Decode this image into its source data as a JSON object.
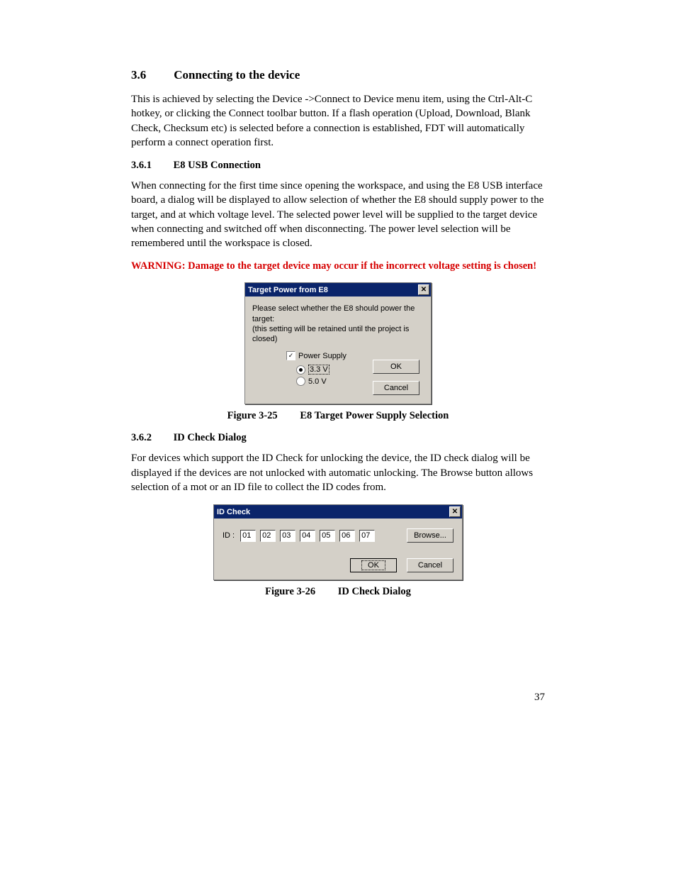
{
  "page_number": "37",
  "section": {
    "number": "3.6",
    "title": "Connecting to the device"
  },
  "para1": "This is achieved by selecting the Device ->Connect to Device menu item, using the Ctrl-Alt-C hotkey, or clicking the Connect toolbar button. If a flash operation (Upload, Download, Blank Check, Checksum etc) is selected before a connection is established, FDT will automatically perform a connect operation first.",
  "sub1": {
    "number": "3.6.1",
    "title": "E8 USB Connection"
  },
  "para2": "When connecting for the first time since opening the workspace, and using the E8 USB interface board, a dialog will be displayed to allow selection of whether the E8 should supply power to the target, and at which voltage level. The selected power level will be supplied to the target device when connecting and switched off when disconnecting. The power level selection will be remembered until the workspace is closed.",
  "warning": "WARNING: Damage to the target device may occur if the incorrect voltage setting is chosen!",
  "fig1": {
    "ref": "Figure 3-25",
    "caption": "E8 Target Power Supply Selection"
  },
  "tp": {
    "title": "Target Power from E8",
    "msg1": "Please select whether the E8 should power the target:",
    "msg2": "(this setting will be retained until the project is closed)",
    "checkbox": "Power Supply",
    "opt1": "3.3 V",
    "opt2": "5.0 V",
    "ok": "OK",
    "cancel": "Cancel"
  },
  "sub2": {
    "number": "3.6.2",
    "title": "ID Check Dialog"
  },
  "para3": "For devices which support the ID Check for unlocking the device, the ID check dialog will be displayed if the devices are not unlocked with automatic unlocking. The Browse button allows selection of a mot or an ID file to collect the ID codes from.",
  "idc": {
    "title": "ID Check",
    "label": "ID :",
    "values": [
      "01",
      "02",
      "03",
      "04",
      "05",
      "06",
      "07"
    ],
    "browse": "Browse...",
    "ok": "OK",
    "cancel": "Cancel"
  },
  "fig2": {
    "ref": "Figure 3-26",
    "caption": "ID Check Dialog"
  }
}
